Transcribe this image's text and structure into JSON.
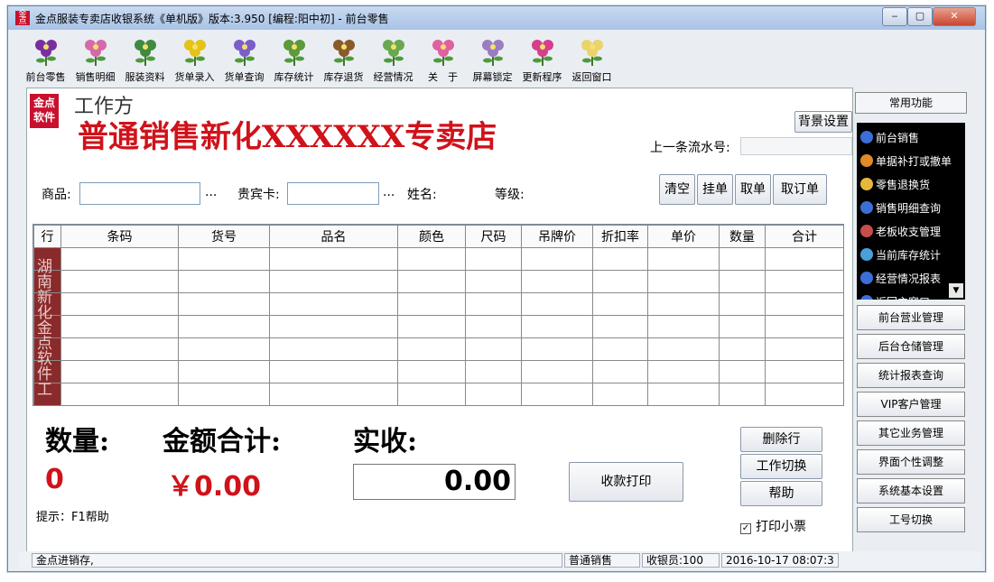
{
  "window": {
    "title": "金点服装专卖店收银系统《单机版》版本:3.950   [编程:阳中初]   - 前台零售",
    "logo_text": "金点"
  },
  "toolbar": [
    {
      "label": "前台零售",
      "icon": "purple-flower-icon",
      "color": "#7a2fa0"
    },
    {
      "label": "销售明细",
      "icon": "pink-flower-icon",
      "color": "#d46aa8"
    },
    {
      "label": "服装资料",
      "icon": "green-plant-icon",
      "color": "#3f8a3f"
    },
    {
      "label": "货单录入",
      "icon": "yellow-flower-icon",
      "color": "#e3c316"
    },
    {
      "label": "货单查询",
      "icon": "violet-flower-icon",
      "color": "#7b5ec9"
    },
    {
      "label": "库存统计",
      "icon": "leaf-icon",
      "color": "#5c9a3a"
    },
    {
      "label": "库存退货",
      "icon": "acorn-icon",
      "color": "#8a5a2b"
    },
    {
      "label": "经营情况",
      "icon": "sprout-icon",
      "color": "#6aa84f"
    },
    {
      "label": "关　于",
      "icon": "pink-daisy-icon",
      "color": "#e060a0"
    },
    {
      "label": "屏幕锁定",
      "icon": "lavender-icon",
      "color": "#9b7cc4"
    },
    {
      "label": "更新程序",
      "icon": "magenta-flower-icon",
      "color": "#d53f8c"
    },
    {
      "label": "返回窗口",
      "icon": "white-flower-icon",
      "color": "#e9d36b"
    }
  ],
  "header": {
    "logo_text": "金点软件",
    "mode_label": "工作方",
    "mode_value": "普通销售",
    "store_banner": "新化XXXXXX专卖店",
    "bg_settings": "背景设置",
    "last_serial_label": "上一条流水号:"
  },
  "form": {
    "product_label": "商品:",
    "product_value": "",
    "vip_label": "贵宾卡:",
    "vip_value": "",
    "ellipsis": "...",
    "name_label": "姓名:",
    "level_label": "等级:",
    "buttons": [
      "清空",
      "挂单",
      "取单",
      "取订单"
    ]
  },
  "table": {
    "columns": [
      "行",
      "条码",
      "货号",
      "品名",
      "颜色",
      "尺码",
      "吊牌价",
      "折扣率",
      "单价",
      "数量",
      "合计"
    ],
    "watermark": "湖南新化金点软件工",
    "row_count": 7
  },
  "totals": {
    "qty_label": "数量:",
    "qty_value": "0",
    "amount_label": "金额合计:",
    "amount_value": "￥0.00",
    "received_label": "实收:",
    "received_value": "0.00",
    "hint": "提示：F1帮助",
    "checkout_button": "收款打印",
    "delete_row": "删除行",
    "switch_work": "工作切换",
    "help": "帮助",
    "print_ticket": "打印小票",
    "print_ticket_checked": true
  },
  "sidebar": {
    "header": "常用功能",
    "items": [
      {
        "label": "前台销售",
        "color": "#3b6fd8"
      },
      {
        "label": "单据补打或撤单",
        "color": "#e08a2a"
      },
      {
        "label": "零售退换货",
        "color": "#e6b83a"
      },
      {
        "label": "销售明细查询",
        "color": "#3b6fd8"
      },
      {
        "label": "老板收支管理",
        "color": "#c94c4c"
      },
      {
        "label": "当前库存统计",
        "color": "#4aa0d8"
      },
      {
        "label": "经营情况报表",
        "color": "#3b6fd8"
      },
      {
        "label": "返回主窗口",
        "color": "#3b6fd8"
      }
    ],
    "buttons": [
      "前台营业管理",
      "后台仓储管理",
      "统计报表查询",
      "VIP客户管理",
      "其它业务管理",
      "界面个性调整",
      "系统基本设置",
      "工号切换"
    ]
  },
  "status": {
    "app": "金点进销存,",
    "mode": "普通销售",
    "cashier": "收银员:100",
    "datetime": "2016-10-17 08:07:3"
  }
}
